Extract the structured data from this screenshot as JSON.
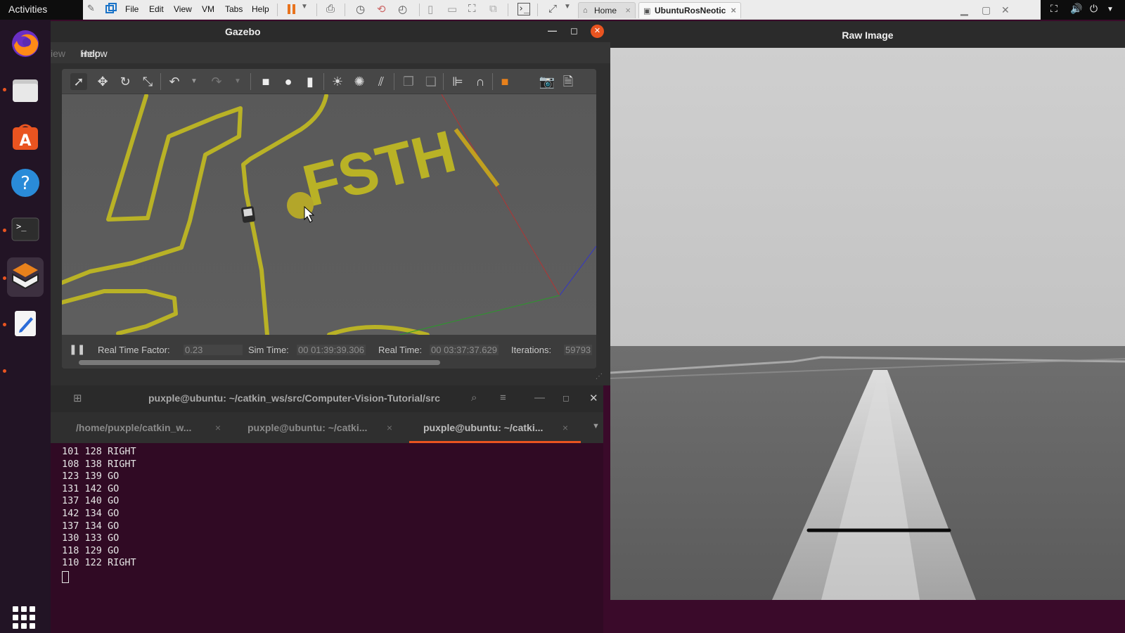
{
  "topbar": {
    "activities": "Activities"
  },
  "vm_menu": [
    "File",
    "Edit",
    "View",
    "VM",
    "Tabs",
    "Help"
  ],
  "vm_tabs": [
    {
      "label": "Home",
      "active": false
    },
    {
      "label": "UbuntuRosNeotic",
      "active": true
    }
  ],
  "gazebo": {
    "title": "Gazebo",
    "menu_partial": "iew",
    "menu_window": "indow",
    "menu_help": "Help",
    "scene_text": "FSTH",
    "status": {
      "rtf_label": "Real Time Factor:",
      "rtf_value": "0.23",
      "sim_label": "Sim Time:",
      "sim_value": "00 01:39:39.306",
      "real_label": "Real Time:",
      "real_value": "00 03:37:37.629",
      "iter_label": "Iterations:",
      "iter_value": "59793"
    }
  },
  "raw_image": {
    "title": "Raw Image"
  },
  "terminal": {
    "title": "puxple@ubuntu: ~/catkin_ws/src/Computer-Vision-Tutorial/src",
    "tabs": [
      {
        "label": "/home/puxple/catkin_w..."
      },
      {
        "label": "puxple@ubuntu: ~/catki..."
      },
      {
        "label": "puxple@ubuntu: ~/catki..."
      }
    ],
    "lines": [
      "101 128 RIGHT",
      "108 138 RIGHT",
      "123 139 GO",
      "131 142 GO",
      "137 140 GO",
      "142 134 GO",
      "137 134 GO",
      "130 133 GO",
      "118 129 GO",
      "110 122 RIGHT"
    ]
  },
  "colors": {
    "accent": "#e95420",
    "terminal_bg": "#300a24",
    "track_yellow": "#b9b226"
  }
}
